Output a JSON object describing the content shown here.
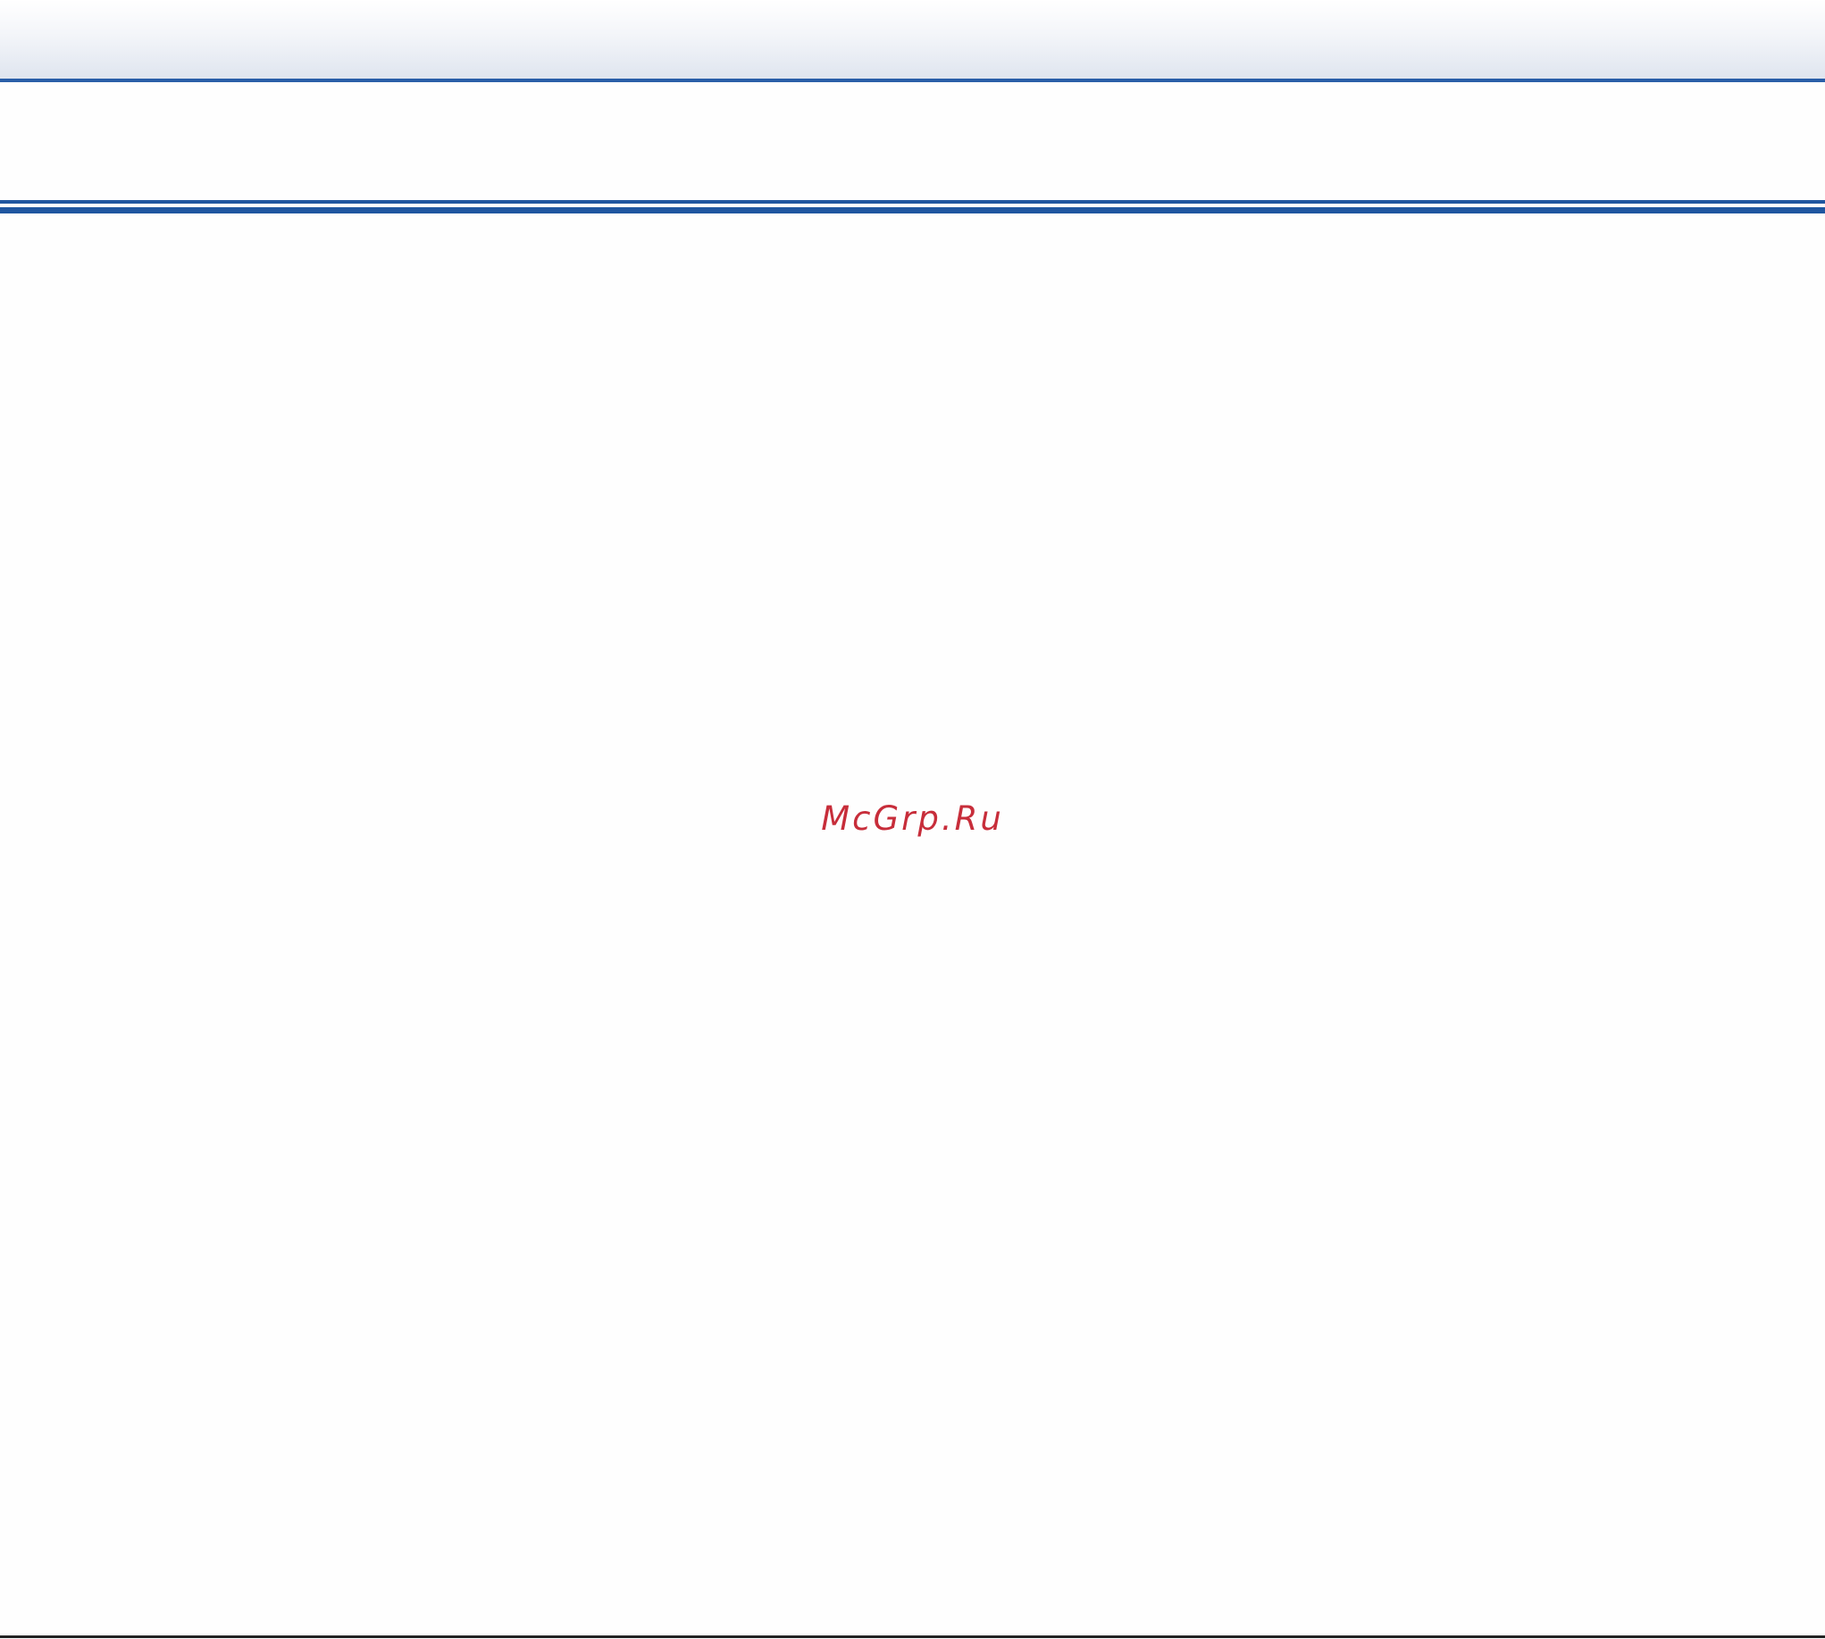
{
  "watermark": {
    "text": "McGrp.Ru",
    "color": "#c72d3a"
  },
  "colors": {
    "accent_blue": "#1f56a0",
    "footer_rule": "#222222"
  }
}
